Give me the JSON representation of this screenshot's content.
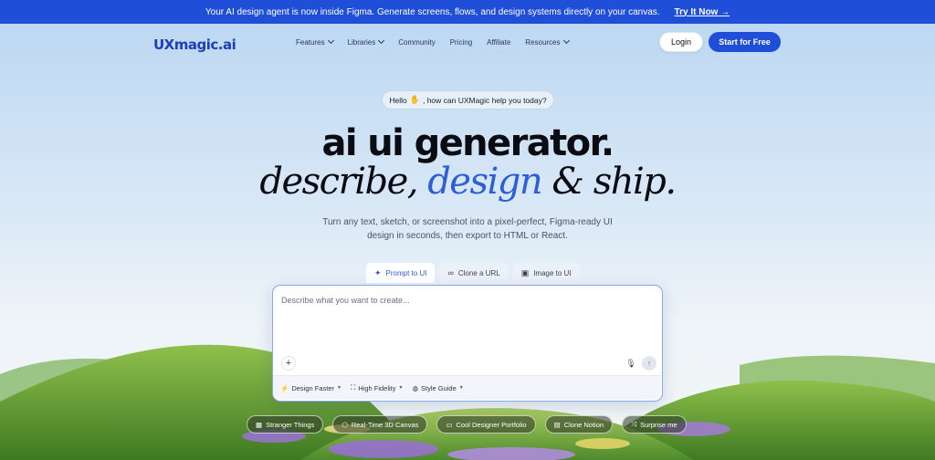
{
  "banner": {
    "text": "Your AI design agent is now inside Figma. Generate screens, flows, and design systems directly on your canvas.",
    "cta": "Try It Now →"
  },
  "nav": {
    "logo": "UXmagic.ai",
    "items": [
      {
        "label": "Features",
        "dropdown": true
      },
      {
        "label": "Libraries",
        "dropdown": true
      },
      {
        "label": "Community",
        "dropdown": false
      },
      {
        "label": "Pricing",
        "dropdown": false
      },
      {
        "label": "Affiliate",
        "dropdown": false
      },
      {
        "label": "Resources",
        "dropdown": true
      }
    ],
    "login": "Login",
    "start": "Start for Free"
  },
  "hero": {
    "greeting_pre": "Hello",
    "greeting_post": ", how can UXMagic help you today?",
    "title": "ai ui generator.",
    "subtitle_a": "describe, ",
    "subtitle_b": "design",
    "subtitle_c": " & ship.",
    "description": "Turn any text, sketch, or screenshot into a pixel-perfect, Figma-ready UI design in seconds, then export to HTML or React."
  },
  "tabs": [
    {
      "label": "Prompt to UI",
      "icon": "sparkle-icon",
      "active": true
    },
    {
      "label": "Clone a URL",
      "icon": "link-icon",
      "active": false
    },
    {
      "label": "Image to UI",
      "icon": "image-icon",
      "active": false
    }
  ],
  "composer": {
    "placeholder": "Describe what you want to create...",
    "options": [
      {
        "label": "Design Faster",
        "icon": "bolt-icon"
      },
      {
        "label": "High Fidelity",
        "icon": "frame-icon"
      },
      {
        "label": "Style Guide",
        "icon": "palette-icon"
      }
    ]
  },
  "suggestions": [
    {
      "label": "Stranger Things",
      "icon": "grid-icon"
    },
    {
      "label": "Real-Time 3D Canvas",
      "icon": "cube-icon"
    },
    {
      "label": "Cool Designer Portfolio",
      "icon": "portfolio-icon"
    },
    {
      "label": "Clone Notion",
      "icon": "notion-icon"
    },
    {
      "label": "Surprise me",
      "icon": "shuffle-icon"
    }
  ],
  "colors": {
    "brand": "#1f4fd8",
    "accent": "#2d5ed8"
  }
}
